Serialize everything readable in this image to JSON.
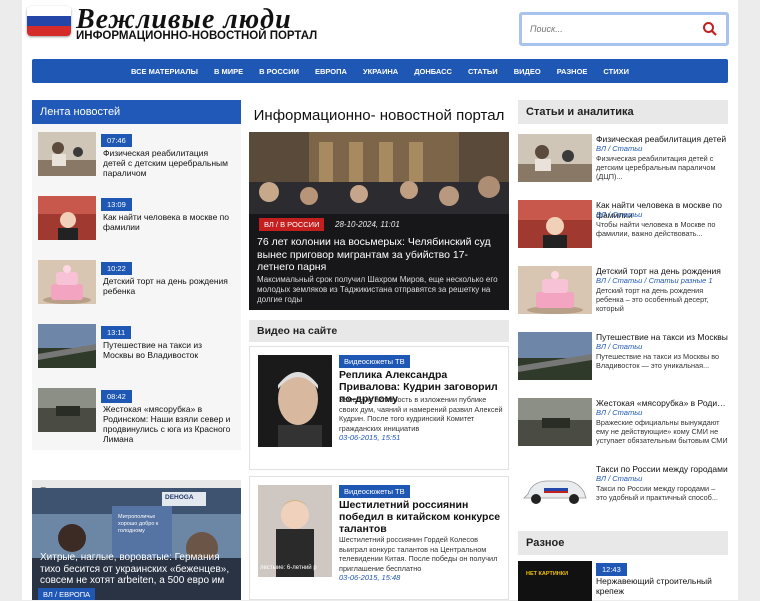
{
  "site": {
    "title": "Вежливые люди",
    "subtitle": "ИНФОРМАЦИОННО-НОВОСТНОЙ ПОРТАЛ",
    "flag_colors": [
      "#ffffff",
      "#2446a8",
      "#d52b2b"
    ]
  },
  "search": {
    "placeholder": "Поиск...",
    "icon": "search-icon",
    "icon_color": "#c41f1f"
  },
  "nav": {
    "items": [
      "ВСЕ МАТЕРИАЛЫ",
      "В МИРЕ",
      "В РОССИИ",
      "ЕВРОПА",
      "УКРАИНА",
      "ДОНБАСС",
      "СТАТЬИ",
      "ВИДЕО",
      "РАЗНОЕ",
      "СТИХИ"
    ],
    "color": "#1f57b5"
  },
  "left": {
    "feed_title": "Лента новостей",
    "feed": [
      {
        "time": "07:46",
        "title": "Физическая реабилитация детей с детским церебральным параличом"
      },
      {
        "time": "13:09",
        "title": "Как найти человека в москве по фамилии"
      },
      {
        "time": "10:22",
        "title": "Детский торт на день рождения ребенка"
      },
      {
        "time": "13:11",
        "title": "Путешествие на такси из Москвы во Владивосток"
      },
      {
        "time": "08:42",
        "title": "Жестокая «мясорубка» в Родинском: Наши взяли север и продвинулись с юга из Красного Лимана"
      }
    ],
    "world_title": "В мире",
    "world_item": {
      "title": "Хитрые, наглые, вороватые: Германия тихо бесится от украинских «беженцев», совсем не хотят arbeiten, а 500 евро им плати",
      "category": "ВЛ / ЕВРОПА",
      "sign": "DEHOGA",
      "poster": "Митрополичье хорошо добро к голодному"
    }
  },
  "middle": {
    "title": "Информационно- новостной портал",
    "hero": {
      "category": "ВЛ / В РОССИИ",
      "date": "28-10-2024, 11:01",
      "title": "76 лет колонии на восьмерых: Челябинский суд вынес приговор мигрантам за убийство 17-летнего парня",
      "desc": "Максимальный срок получил Шахром Миров, еще несколько его молодых земляков из Таджикистана отправятся за решетку на долгие годы"
    },
    "video_title": "Видео на сайте",
    "videos": [
      {
        "category": "Видеосюжеты ТВ",
        "title": "Реплика Александра Привалова: Кудрин заговорил по-другому",
        "desc": "Заметную активность в изложении публике своих дум, чаяний и намерений развил Алексей Кудрин. После того кудринский Комитет гражданских инициатив",
        "date": "03-06-2015, 15:51"
      },
      {
        "category": "Видеосюжеты ТВ",
        "title": "Шестилетний россиянин победил в китайском конкурсе талантов",
        "desc": "Шестилетний россиянин Гордей Колесов выиграл конкурс талантов на Центральном телевидении Китая. После победы он получил приглашение бесплатно",
        "date": "03-06-2015, 15:48",
        "caption": "лестыие: 6-летний р"
      }
    ]
  },
  "right": {
    "title": "Статьи и аналитика",
    "items": [
      {
        "title": "Физическая реабилитация детей",
        "category": "ВЛ / Статьи",
        "desc": "Физическая реабилитация детей с детским церебральным параличом (ДЦП)..."
      },
      {
        "title": "Как найти человека в москве по фамилии",
        "category": "ВЛ / Статьи",
        "desc": "Чтобы найти человека в Москве по фамилии, важно действовать..."
      },
      {
        "title": "Детский торт на день рождения",
        "category": "ВЛ / Статьи / Статьи разные 1",
        "desc": "Детский торт на день рождения ребенка – это особенный десерт, который"
      },
      {
        "title": "Путешествие на такси из Москвы",
        "category": "ВЛ / Статьи",
        "desc": "Путешествие на такси из Москвы во Владивосток — это уникальная..."
      },
      {
        "title": "Жестокая «мясорубка» в Родинском",
        "category": "ВЛ / Статьи",
        "desc": "Вражеские официальны вынуждают ему не действующие» кому СМИ не уступает обязательным бытовым СМИ публике, снова ВСУ..."
      },
      {
        "title": "Такси по России между городами",
        "category": "ВЛ / Статьи",
        "desc": "Такси по России между городами – это удобный и практичный способ..."
      }
    ],
    "misc_title": "Разное",
    "misc_item": {
      "time": "12:43",
      "title": "Нержавеющий строительный крепеж",
      "badge": "НЕТ КАРТИНКИ"
    }
  }
}
